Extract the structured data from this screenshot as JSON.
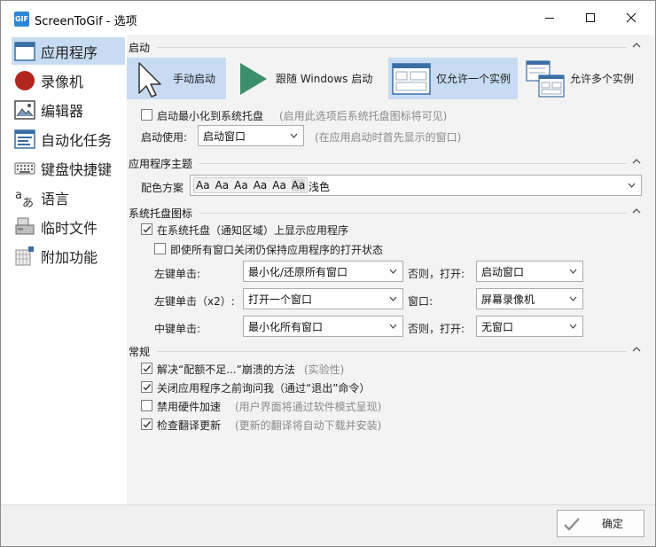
{
  "window": {
    "app_icon_text": "GIF",
    "title": "ScreenToGif - 选项"
  },
  "sidebar": {
    "items": [
      {
        "label": "应用程序",
        "icon": "app-window-icon"
      },
      {
        "label": "录像机",
        "icon": "record-circle-icon"
      },
      {
        "label": "编辑器",
        "icon": "image-editor-icon"
      },
      {
        "label": "自动化任务",
        "icon": "task-list-icon"
      },
      {
        "label": "键盘快捷键",
        "icon": "keyboard-icon"
      },
      {
        "label": "语言",
        "icon": "language-icon"
      },
      {
        "label": "临时文件",
        "icon": "temp-files-icon"
      },
      {
        "label": "附加功能",
        "icon": "extras-icon"
      }
    ]
  },
  "startup": {
    "title": "启动",
    "modes": [
      {
        "label": "手动启动",
        "icon": "cursor-icon"
      },
      {
        "label": "跟随 Windows 启动",
        "icon": "play-icon"
      },
      {
        "label": "仅允许一个实例",
        "icon": "single-instance-icon"
      },
      {
        "label": "允许多个实例",
        "icon": "multi-instance-icon"
      }
    ],
    "minimize_tray_label": "启动最小化到系统托盘",
    "minimize_tray_hint": "(启用此选项后系统托盘图标将可见)",
    "start_using_label": "启动使用:",
    "start_using_value": "启动窗口",
    "start_using_hint": "(在应用启动时首先显示的窗口)"
  },
  "theme": {
    "title": "应用程序主题",
    "scheme_label": "配色方案",
    "samples": [
      "Aa",
      "Aa",
      "Aa",
      "Aa",
      "Aa",
      "Aa"
    ],
    "value": "浅色"
  },
  "tray": {
    "title": "系统托盘图标",
    "show_in_tray_label": "在系统托盘（通知区域）上显示应用程序",
    "keep_open_label": "即使所有窗口关闭仍保持应用程序的打开状态",
    "left_click_label": "左键单击:",
    "left_click_value": "最小化/还原所有窗口",
    "left_click_else_label": "否则，打开:",
    "left_click_else_value": "启动窗口",
    "double_click_label": "左键单击（x2）:",
    "double_click_value": "打开一个窗口",
    "double_click_window_label": "窗口:",
    "double_click_window_value": "屏幕录像机",
    "middle_click_label": "中键单击:",
    "middle_click_value": "最小化所有窗口",
    "middle_click_else_label": "否则，打开:",
    "middle_click_else_value": "无窗口"
  },
  "general": {
    "title": "常规",
    "items": [
      {
        "label": "解决“配额不足...”崩溃的方法",
        "hint": "(实验性)",
        "checked": true
      },
      {
        "label": "关闭应用程序之前询问我（通过“退出”命令）",
        "hint": "",
        "checked": true
      },
      {
        "label": "禁用硬件加速",
        "hint": "(用户界面将通过软件模式呈现)",
        "checked": false
      },
      {
        "label": "检查翻译更新",
        "hint": "(更新的翻译将自动下载并安装)",
        "checked": true
      }
    ]
  },
  "footer": {
    "ok_label": "确定"
  },
  "colors": {
    "accent_selected": "#c7dcf3",
    "content_bg": "#f3f3f3",
    "hint_text": "#8a8a8a",
    "record_red": "#b3261e",
    "play_green": "#3c8f6b"
  }
}
